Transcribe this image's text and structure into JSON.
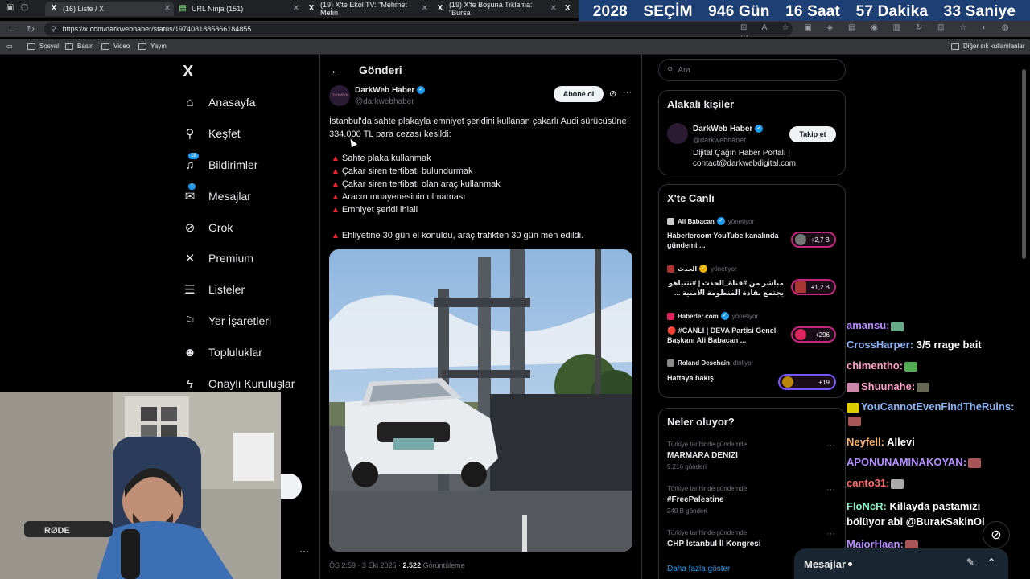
{
  "browser": {
    "tabs": [
      {
        "title": "(16) Liste / X",
        "icon": "x-logo-icon"
      },
      {
        "title": "URL Ninja (151)",
        "icon": "url-ninja-icon"
      },
      {
        "title": "(19) X'te Ekol TV: \"Mehmet Metin",
        "icon": "x-logo-icon"
      },
      {
        "title": "(19) X'te Boşuna Tıklama: \"Bursa",
        "icon": "x-logo-icon"
      }
    ],
    "url": "https://x.com/darkwebhaber/status/1974081885866184855",
    "bookmarks": [
      "Sosyal",
      "Basın",
      "Video",
      "Yayın"
    ],
    "other_bookmarks": "Diğer sık kullanılanlar"
  },
  "countdown": {
    "year": "2028",
    "label": "SEÇİM",
    "days": "946 Gün",
    "hours": "16 Saat",
    "minutes": "57 Dakika",
    "seconds": "33 Saniye"
  },
  "sidebar": {
    "logo": "X",
    "items": [
      {
        "label": "Anasayfa",
        "icon": "home-icon",
        "glyph": "⌂"
      },
      {
        "label": "Keşfet",
        "icon": "search-icon",
        "glyph": "⌕"
      },
      {
        "label": "Bildirimler",
        "icon": "bell-icon",
        "glyph": "🔔",
        "badge": "18"
      },
      {
        "label": "Mesajlar",
        "icon": "mail-icon",
        "glyph": "✉",
        "badge": "1"
      },
      {
        "label": "Grok",
        "icon": "grok-icon",
        "glyph": "⊘"
      },
      {
        "label": "Premium",
        "icon": "x-premium-icon",
        "glyph": "𝕏"
      },
      {
        "label": "Listeler",
        "icon": "list-icon",
        "glyph": "☰"
      },
      {
        "label": "Yer İşaretleri",
        "icon": "bookmark-icon",
        "glyph": "⚐"
      },
      {
        "label": "Topluluklar",
        "icon": "communities-icon",
        "glyph": "👥"
      },
      {
        "label": "Onaylı Kuruluşlar",
        "icon": "lightning-icon",
        "glyph": "⚡"
      }
    ]
  },
  "post": {
    "page_title": "Gönderi",
    "author_name": "DarkWeb Haber",
    "author_handle": "@darkwebhaber",
    "avatar_text": "DarkWeb",
    "subscribe_label": "Abone ol",
    "intro": "İstanbul'da sahte plakayla emniyet şeridini kullanan çakarlı Audi sürücüsüne 334.000 TL para cezası kesildi:",
    "bullets": [
      "Sahte plaka kullanmak",
      "Çakar siren tertibatı bulundurmak",
      "Çakar siren tertibatı olan araç kullanmak",
      "Aracın muayenesinin olmaması",
      "Emniyet şeridi ihlali"
    ],
    "footer_line": "Ehliyetine 30 gün el konuldu, araç trafikten 30 gün men edildi.",
    "time": "ÖS 2:59 · 3 Eki 2025 · ",
    "views_count": "2.522",
    "views_label": " Görüntüleme"
  },
  "search": {
    "placeholder": "Ara"
  },
  "related": {
    "title": "Alakalı kişiler",
    "name": "DarkWeb Haber",
    "handle": "@darkwebhaber",
    "bio": "Dijital Çağın Haber Portalı | contact@darkwebdigital.com",
    "follow_label": "Takip et"
  },
  "live": {
    "title": "X'te Canlı",
    "items": [
      {
        "host": "Ali Babacan",
        "role": "yönetiyor",
        "title": "Haberlercom YouTube kanalında gündemi ...",
        "count": "+2,7 B",
        "color": "#cccccc"
      },
      {
        "host": "الحدث",
        "role": "yönetiyor",
        "title": "مباشر من #قناة_الحدث | #نتنياهو يجتمع بقادة المنظومة الأمنية ...",
        "count": "+1,2 B",
        "color": "#a33"
      },
      {
        "host": "Haberler.com",
        "role": "yönetiyor",
        "title": "🔴 #CANLI | DEVA Partisi Genel Başkanı Ali Babacan ...",
        "count": "+296",
        "color": "#e0245e"
      },
      {
        "host": "Roland Deschain",
        "role": "dinliyor",
        "title": "Haftaya bakış",
        "count": "+19",
        "color": "#888"
      }
    ]
  },
  "trends": {
    "title": "Neler oluyor?",
    "items": [
      {
        "category": "Türkiye tarihinde gündemde",
        "name": "MARMARA DENIZI",
        "count": "9.216 gönderi"
      },
      {
        "category": "Türkiye tarihinde gündemde",
        "name": "#FreePalestine",
        "count": "240 B gönderi"
      },
      {
        "category": "Türkiye tarihinde gündemde",
        "name": "CHP İstanbul İl Kongresi",
        "count": ""
      }
    ],
    "show_more": "Daha fazla göster"
  },
  "chat": [
    {
      "user": "amansu:",
      "color": "#b48cff",
      "msg": "",
      "emote": "#6a8"
    },
    {
      "user": "CrossHarper:",
      "color": "#8ab4f8",
      "msg": "3/5 rrage bait",
      "emote": ""
    },
    {
      "user": "chimentho:",
      "color": "#ff9ec8",
      "msg": "",
      "emote": "#5a5"
    },
    {
      "user": "Shuunahe:",
      "color": "#ff9ec8",
      "msg": "",
      "emote": "#665"
    },
    {
      "user": "YouCannotEvenFindTheRuins:",
      "color": "#8ab4f8",
      "msg": "",
      "emote": "#a55"
    },
    {
      "user": "Neyfell:",
      "color": "#ffb86b",
      "msg": "Allevi",
      "emote": ""
    },
    {
      "user": "APONUNAMINAKOYAN:",
      "color": "#b48cff",
      "msg": "",
      "emote": "#a55"
    },
    {
      "user": "canto31:",
      "color": "#ff6b6b",
      "msg": "",
      "emote": "#aaa"
    },
    {
      "user": "FloNcR:",
      "color": "#7cf5c8",
      "msg": "Killayda pastamızı",
      "emote": ""
    },
    {
      "user": "",
      "color": "#fff",
      "msg": "bölüyor abi @BurakSakinOl",
      "emote": ""
    },
    {
      "user": "MajorHaan:",
      "color": "#b48cff",
      "msg": "",
      "emote": "#a55"
    }
  ],
  "messages_bar": {
    "label": "Mesajlar"
  },
  "colors": {
    "accent": "#1d9bf0",
    "background": "#000000",
    "countdown_bg": "#1e3f74"
  }
}
